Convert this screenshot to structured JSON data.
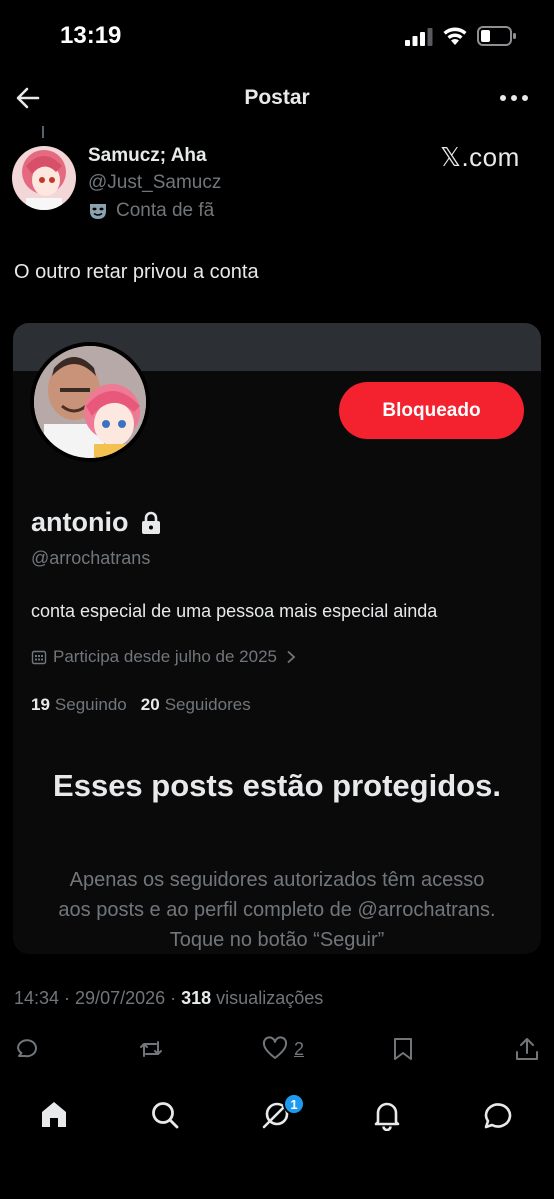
{
  "status_bar": {
    "time": "13:19",
    "icons": [
      "signal-icon",
      "wifi-icon",
      "battery-icon"
    ]
  },
  "header": {
    "title": "Postar",
    "back_icon": "arrow-left-icon",
    "more_icon": "more-icon"
  },
  "post": {
    "author_name": "Samucz; Aha",
    "author_handle": "@Just_Samucz",
    "fan_label": "Conta de fã",
    "source": "𝕏.com",
    "text": "O outro retar privou a conta",
    "timestamp": "14:34 · 29/07/2026 ·",
    "views": "318",
    "views_label": "visualizações",
    "likes": "2"
  },
  "embedded_profile": {
    "button_label": "Bloqueado",
    "name": "antonio",
    "handle": "@arrochatrans",
    "bio": "conta especial de uma pessoa mais especial ainda",
    "joined": "Participa desde julho de 2025",
    "following_count": "19",
    "following_label": "Seguindo",
    "followers_count": "20",
    "followers_label": "Seguidores",
    "protected_title": "Esses posts estão protegidos.",
    "protected_description": "Apenas os seguidores autorizados têm acesso aos posts e ao perfil completo de @arrochatrans. Toque no botão “Seguir”"
  },
  "tab_bar": {
    "messages_badge": "1",
    "tabs": [
      "home-icon",
      "search-icon",
      "grok-icon",
      "bell-icon",
      "messages-icon"
    ]
  },
  "colors": {
    "background": "#000000",
    "accent": "#1d9bf0",
    "blocked": "#f4212e",
    "muted": "#71767b",
    "text": "#e7e9ea"
  }
}
